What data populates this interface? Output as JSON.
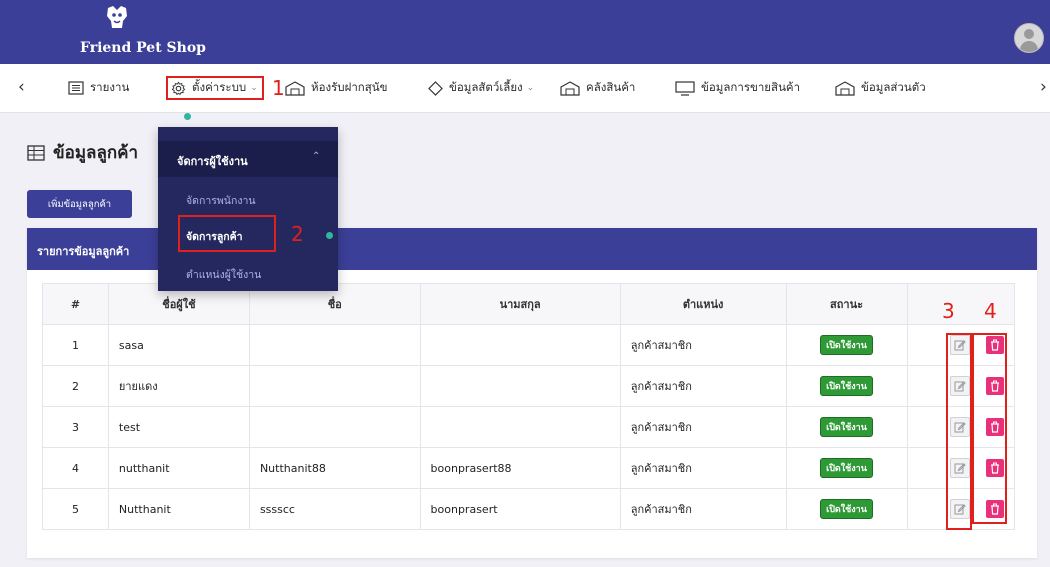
{
  "brand": {
    "name": "Friend Pet Shop"
  },
  "nav": {
    "items": [
      {
        "label": "รายงาน",
        "icon": "list-icon"
      },
      {
        "label": "ตั้งค่าระบบ",
        "icon": "gear-icon"
      },
      {
        "label": "ห้องรับฝากสุนัข",
        "icon": "building-icon"
      },
      {
        "label": "ข้อมูลสัตว์เลี้ยง",
        "icon": "diamond-icon"
      },
      {
        "label": "คลังสินค้า",
        "icon": "building-icon"
      },
      {
        "label": "ข้อมูลการขายสินค้า",
        "icon": "monitor-icon"
      },
      {
        "label": "ข้อมูลส่วนตัว",
        "icon": "building-icon"
      }
    ]
  },
  "dropdown": {
    "group_label": "จัดการผู้ใช้งาน",
    "items": [
      {
        "label": "จัดการพนักงาน"
      },
      {
        "label": "จัดการลูกค้า"
      },
      {
        "label": "ตำแหน่งผู้ใช้งาน"
      }
    ]
  },
  "page": {
    "title": "ข้อมูลลูกค้า",
    "add_button": "เพิ่มข้อมูลลูกค้า",
    "card_title": "รายการข้อมูลลูกค้า"
  },
  "table": {
    "headers": [
      "#",
      "ชื่อผู้ใช้",
      "ชื่อ",
      "นามสกุล",
      "ตำแหน่ง",
      "สถานะ",
      ""
    ],
    "rows": [
      {
        "no": "1",
        "username": "sasa",
        "first": "",
        "last": "",
        "role": "ลูกค้าสมาชิก",
        "status": "เปิดใช้งาน"
      },
      {
        "no": "2",
        "username": "ยายแดง",
        "first": "",
        "last": "",
        "role": "ลูกค้าสมาชิก",
        "status": "เปิดใช้งาน"
      },
      {
        "no": "3",
        "username": "test",
        "first": "",
        "last": "",
        "role": "ลูกค้าสมาชิก",
        "status": "เปิดใช้งาน"
      },
      {
        "no": "4",
        "username": "nutthanit",
        "first": "Nutthanit88",
        "last": "boonprasert88",
        "role": "ลูกค้าสมาชิก",
        "status": "เปิดใช้งาน"
      },
      {
        "no": "5",
        "username": "Nutthanit",
        "first": "sssscc",
        "last": "boonprasert",
        "role": "ลูกค้าสมาชิก",
        "status": "เปิดใช้งาน"
      }
    ]
  },
  "annotations": [
    "1",
    "2",
    "3",
    "4"
  ],
  "colors": {
    "primary": "#3b3f97",
    "dropdown": "#25285f",
    "status_green": "#2e9a36",
    "delete_pink": "#e8317a",
    "annotation_red": "#e0201a",
    "indicator_teal": "#2fb5a0"
  }
}
